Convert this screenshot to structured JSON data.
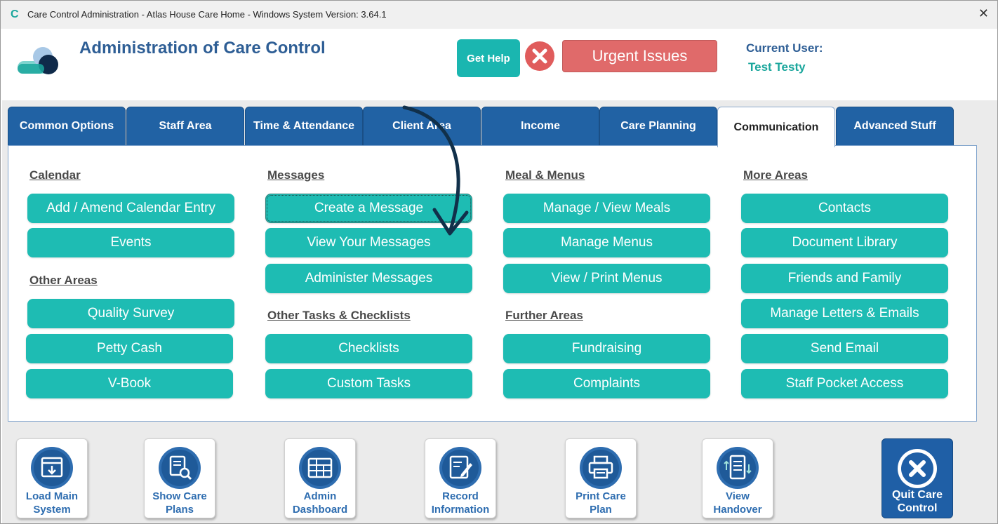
{
  "window": {
    "app_icon_glyph": "C",
    "title": "Care Control Administration - Atlas House Care Home - Windows System Version: 3.64.1",
    "close_glyph": "✕"
  },
  "header": {
    "title": "Administration of Care Control",
    "get_help": "Get Help",
    "urgent_issues": "Urgent Issues",
    "current_user_label": "Current User:",
    "current_user_name": "Test Testy"
  },
  "tabs": [
    {
      "label": "Common Options"
    },
    {
      "label": "Staff Area"
    },
    {
      "label": "Time & Attendance"
    },
    {
      "label": "Client Area"
    },
    {
      "label": "Income"
    },
    {
      "label": "Care Planning"
    },
    {
      "label": "Communication"
    },
    {
      "label": "Advanced Stuff"
    }
  ],
  "active_tab": "Communication",
  "sections": {
    "calendar": {
      "heading": "Calendar",
      "buttons": [
        "Add / Amend Calendar Entry",
        "Events"
      ]
    },
    "other_areas": {
      "heading": "Other Areas",
      "buttons": [
        "Quality Survey",
        "Petty Cash",
        "V-Book"
      ]
    },
    "messages": {
      "heading": "Messages",
      "buttons": [
        "Create a Message",
        "View Your Messages",
        "Administer Messages"
      ]
    },
    "other_tasks": {
      "heading": "Other Tasks & Checklists",
      "buttons": [
        "Checklists",
        "Custom Tasks"
      ]
    },
    "meals": {
      "heading": "Meal & Menus",
      "buttons": [
        "Manage / View Meals",
        "Manage Menus",
        "View / Print Menus"
      ]
    },
    "further": {
      "heading": "Further Areas",
      "buttons": [
        "Fundraising",
        "Complaints"
      ]
    },
    "more": {
      "heading": "More Areas",
      "buttons": [
        "Contacts",
        "Document Library",
        "Friends and Family",
        "Manage Letters & Emails",
        "Send Email",
        "Staff Pocket Access"
      ]
    }
  },
  "toolbar": {
    "load_main": {
      "line1": "Load Main",
      "line2": "System"
    },
    "show_care_plans": {
      "line1": "Show Care",
      "line2": "Plans"
    },
    "admin_dashboard": {
      "line1": "Admin",
      "line2": "Dashboard"
    },
    "record_information": {
      "line1": "Record",
      "line2": "Information"
    },
    "print_care_plan": {
      "line1": "Print Care",
      "line2": "Plan"
    },
    "view_handover": {
      "line1": "View",
      "line2": "Handover"
    },
    "quit": {
      "line1": "Quit Care",
      "line2": "Control"
    }
  },
  "colors": {
    "teal": "#1ebcb3",
    "tab_blue": "#2162a4",
    "urgent_red": "#e06a6a",
    "title_blue": "#2e5e95"
  }
}
